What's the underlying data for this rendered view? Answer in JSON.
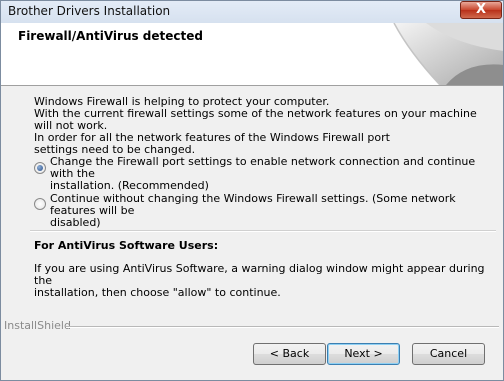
{
  "window": {
    "title": "Brother Drivers Installation",
    "close_label": "X"
  },
  "header": {
    "title": "Firewall/AntiVirus detected"
  },
  "intro": {
    "line1": "Windows Firewall is helping to protect your computer.",
    "line2": "With the current firewall settings some of the network features on your machine will not work.",
    "line3": "In order for all the network features of the Windows Firewall port",
    "line4": "settings need to be changed."
  },
  "options": [
    {
      "line1": "Change the Firewall port settings to enable network connection and continue with the",
      "line2": "installation. (Recommended)",
      "selected": true
    },
    {
      "line1": "Continue without changing the Windows Firewall settings. (Some network features will be",
      "line2": "disabled)",
      "selected": false
    }
  ],
  "antivirus": {
    "heading": "For AntiVirus Software Users:",
    "line1": "If you are using AntiVirus Software, a warning dialog window might appear during the",
    "line2": "installation, then choose \"allow\" to continue."
  },
  "footer": {
    "brand": "InstallShield",
    "back": "< Back",
    "next": "Next >",
    "cancel": "Cancel"
  }
}
